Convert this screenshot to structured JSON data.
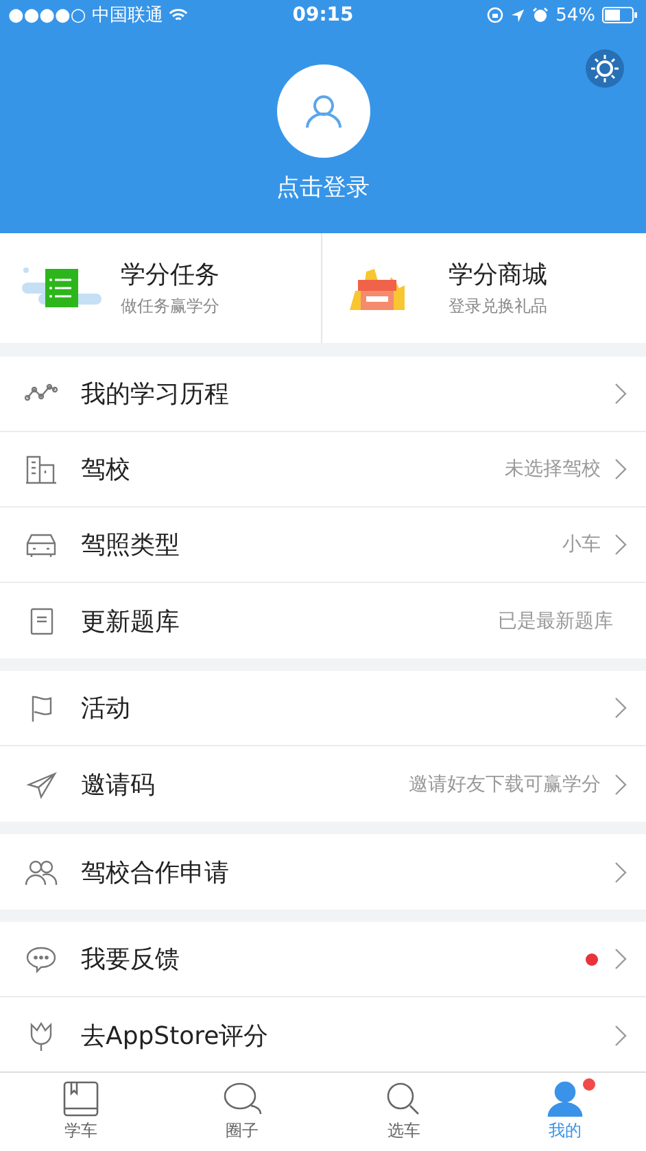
{
  "status_bar": {
    "carrier": "●●●●○ 中国联通",
    "time": "09:15",
    "battery": "54%"
  },
  "header": {
    "login": "点击登录"
  },
  "cards": [
    {
      "kind": "tasks",
      "title": "学分任务",
      "subtitle": "做任务赢学分"
    },
    {
      "kind": "mall",
      "title": "学分商城",
      "subtitle": "登录兑换礼品"
    }
  ],
  "groups": [
    [
      {
        "label": "我的学习历程",
        "chevron": true,
        "dot": false
      },
      {
        "label": "驾校",
        "value": "未选择驾校",
        "chevron": true,
        "dot": false
      },
      {
        "label": "驾照类型",
        "value": "小车",
        "chevron": true,
        "dot": false
      },
      {
        "label": "更新题库",
        "value": "已是最新题库",
        "chevron": false,
        "dot": false
      }
    ],
    [
      {
        "label": "活动",
        "chevron": true,
        "dot": false
      },
      {
        "label": "邀请码",
        "value": "邀请好友下载可赢学分",
        "chevron": true,
        "dot": false
      }
    ],
    [
      {
        "label": "驾校合作申请",
        "chevron": true,
        "dot": false
      }
    ],
    [
      {
        "label": "我要反馈",
        "chevron": true,
        "dot": true
      },
      {
        "label": "去AppStore评分",
        "chevron": true,
        "dot": false
      }
    ]
  ],
  "tabs": [
    {
      "label": "学车",
      "selected": false,
      "badge": false
    },
    {
      "label": "圈子",
      "selected": false,
      "badge": false
    },
    {
      "label": "选车",
      "selected": false,
      "badge": false
    },
    {
      "label": "我的",
      "selected": true,
      "badge": true
    }
  ]
}
